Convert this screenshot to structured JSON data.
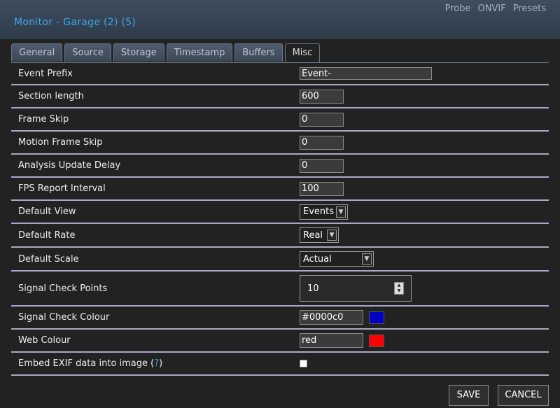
{
  "header": {
    "title": "Monitor - Garage (2) (5)",
    "links": [
      "Probe",
      "ONVIF",
      "Presets"
    ]
  },
  "tabs": [
    "General",
    "Source",
    "Storage",
    "Timestamp",
    "Buffers",
    "Misc"
  ],
  "active_tab": "Misc",
  "fields": {
    "event_prefix": {
      "label": "Event Prefix",
      "value": "Event-"
    },
    "section_length": {
      "label": "Section length",
      "value": "600"
    },
    "frame_skip": {
      "label": "Frame Skip",
      "value": "0"
    },
    "motion_frame_skip": {
      "label": "Motion Frame Skip",
      "value": "0"
    },
    "analysis_update_delay": {
      "label": "Analysis Update Delay",
      "value": "0"
    },
    "fps_report_interval": {
      "label": "FPS Report Interval",
      "value": "100"
    },
    "default_view": {
      "label": "Default View",
      "value": "Events"
    },
    "default_rate": {
      "label": "Default Rate",
      "value": "Real"
    },
    "default_scale": {
      "label": "Default Scale",
      "value": "Actual"
    },
    "signal_check_points": {
      "label": "Signal Check Points",
      "value": "10"
    },
    "signal_check_colour": {
      "label": "Signal Check Colour",
      "value": "#0000c0",
      "swatch": "#0000c0"
    },
    "web_colour": {
      "label": "Web Colour",
      "value": "red",
      "swatch": "#ff0000"
    },
    "embed_exif": {
      "label": "Embed EXIF data into image (",
      "help": "?",
      "label_end": ")",
      "checked": false
    }
  },
  "buttons": {
    "save": "SAVE",
    "cancel": "CANCEL"
  }
}
